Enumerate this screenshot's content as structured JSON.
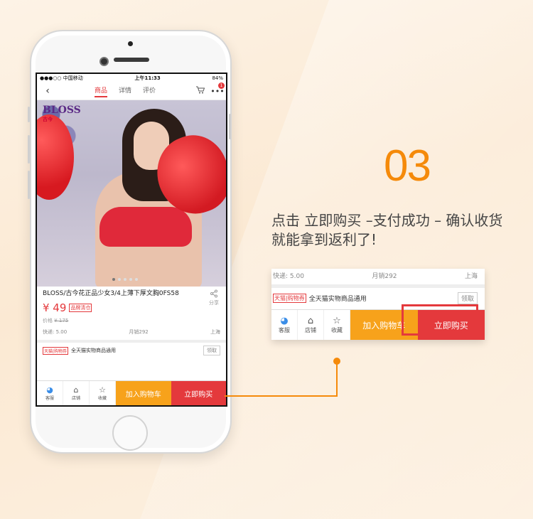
{
  "colors": {
    "accent": "#f58a0a",
    "buy": "#e4393c",
    "cart": "#f7a21b"
  },
  "step": {
    "number": "03",
    "description": "点击 立即购买 –支付成功 – 确认收货就能拿到返利了!"
  },
  "phone": {
    "status": {
      "carrier": "●●●○○ 中国移动",
      "time": "上午11:33",
      "battery": "84%"
    },
    "nav": {
      "back": "‹",
      "tabs": [
        "商品",
        "详情",
        "评价"
      ],
      "badge": "1"
    },
    "product": {
      "brand_logo": "BLOSS",
      "brand_logo_cn": "古今",
      "title": "BLOSS/古今花正品少女3/4上薄下厚文胸0FS58",
      "share": "分享",
      "price": "¥ 49",
      "price_tag": "品牌清仓",
      "old_price_label": "价格",
      "old_price": "¥ 175",
      "shipping": "快递: 5.00",
      "monthly_sales": "月销292",
      "location": "上海"
    },
    "coupon": {
      "tag": "天猫|购物券",
      "text": "全天猫实物商品通用",
      "button": "领取"
    },
    "bottom": {
      "service": "客服",
      "shop": "店铺",
      "favorite": "收藏",
      "add_to_cart": "加入购物车",
      "buy_now": "立即购买"
    }
  },
  "zoom": {
    "shipping": "快递: 5.00",
    "monthly_sales": "月销292",
    "location": "上海",
    "coupon_tag": "天猫|购物券",
    "coupon_text": "全天猫实物商品通用",
    "coupon_button": "领取",
    "service": "客服",
    "shop": "店铺",
    "favorite": "收藏",
    "add_to_cart": "加入购物车",
    "buy_now": "立即购买"
  }
}
